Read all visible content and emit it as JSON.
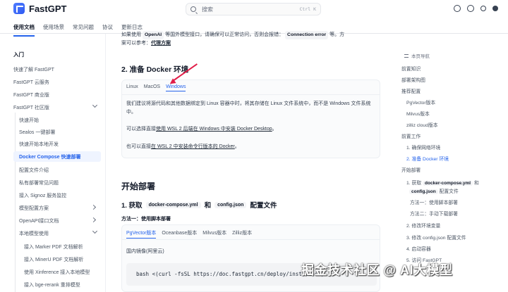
{
  "app": {
    "name": "FastGPT"
  },
  "search": {
    "placeholder": "搜索",
    "shortcut": "Ctrl K"
  },
  "header_icons": [
    "openai-icon",
    "github-icon",
    "sun-icon",
    "moon-icon"
  ],
  "top_tabs": [
    {
      "label": "使用文档",
      "active": true
    },
    {
      "label": "使用场景",
      "active": false
    },
    {
      "label": "常见问题",
      "active": false
    },
    {
      "label": "协议",
      "active": false
    },
    {
      "label": "更新日志",
      "active": false
    }
  ],
  "sidebar": {
    "section": "入门",
    "items": [
      {
        "label": "快速了解 FastGPT"
      },
      {
        "label": "FastGPT 云服务"
      },
      {
        "label": "FastGPT 商业版"
      },
      {
        "label": "FastGPT 社区版"
      },
      {
        "label": "快速开始"
      },
      {
        "label": "Sealos 一键部署"
      },
      {
        "label": "快速开始本地开发"
      },
      {
        "label": "Docker Compose 快速部署"
      },
      {
        "label": "配置文件介绍"
      },
      {
        "label": "私有部署常见问题"
      },
      {
        "label": "接入 Signoz 服务监控"
      },
      {
        "label": "模型配置方案"
      },
      {
        "label": "OpenAPI接口文档"
      },
      {
        "label": "本地模型使用"
      },
      {
        "label": "接入 Marker PDF 文档解析"
      },
      {
        "label": "接入 MinerU PDF 文档解析"
      },
      {
        "label": "使用 Xinference 接入本地模型"
      },
      {
        "label": "接入 bge-rerank 重排模型"
      }
    ]
  },
  "main": {
    "intro_line1_prefix": "如果使用",
    "intro_code1": "OpenAI",
    "intro_line1_mid": "等国外模型接口，请确保可以正常访问，否则会报错：",
    "intro_code2": "Connection error",
    "intro_line1_suffix": "等。方",
    "intro_line2_prefix": "案可以参考：",
    "intro_link": "代理方案",
    "h2_docker": "2. 准备 Docker 环境",
    "os_tabs": [
      {
        "label": "Linux",
        "active": false
      },
      {
        "label": "MacOS",
        "active": false
      },
      {
        "label": "Windows",
        "active": true
      }
    ],
    "win_p1": "我们建议将源代码和其他数据绑定到 Linux 容器中时，将其存储在 Linux 文件系统中，而不是 Windows 文件系统中。",
    "win_p2_prefix": "可以选择直接",
    "win_p2_link": "使用 WSL 2 后端在 Windows 中安装 Docker Desktop",
    "win_p2_suffix": "。",
    "win_p3_prefix": "也可以直接",
    "win_p3_link": "在 WSL 2 中安装命令行版本的 Docker",
    "win_p3_suffix": "。",
    "h2_deploy": "开始部署",
    "h3_get_prefix": "1. 获取",
    "h3_get_code1": "docker-compose.yml",
    "h3_get_and": "和",
    "h3_get_code2": "config.json",
    "h3_get_suffix": "配置文件",
    "method1": "方法一：使用脚本部署",
    "db_tabs": [
      {
        "label": "PgVector版本",
        "active": true
      },
      {
        "label": "Oceanbase版本",
        "active": false
      },
      {
        "label": "Milvus版本",
        "active": false
      },
      {
        "label": "Zilliz版本",
        "active": false
      }
    ],
    "mirror_label": "国内镜像(阿里云)",
    "code_line": "bash <(curl -fsSL https://doc.fastgpt.cn/deploy/install.sh)"
  },
  "toc": {
    "title": "本页导航",
    "items": [
      {
        "label": "前置知识"
      },
      {
        "label": "部署架构图"
      },
      {
        "label": "推荐配置"
      },
      {
        "label": "PgVector版本"
      },
      {
        "label": "Milvus版本"
      },
      {
        "label": "zilliz cloud版本"
      },
      {
        "label": "前置工作"
      },
      {
        "label": "1. 确保网络环境"
      },
      {
        "label": "2. 准备 Docker 环境"
      },
      {
        "label": "开始部署"
      },
      {
        "label": "1. 获取"
      },
      {
        "label": "docker-compose.yml"
      },
      {
        "label": "和"
      },
      {
        "label": "config.json"
      },
      {
        "label": "配置文件"
      },
      {
        "label": "方法一：使用脚本部署"
      },
      {
        "label": "方法二：手动下载部署"
      },
      {
        "label": "2. 修改环境变量"
      },
      {
        "label": "3. 修改 config.json 配置文件"
      },
      {
        "label": "4. 启动容器"
      },
      {
        "label": "5. 访问 FastGPT"
      }
    ]
  },
  "watermark": "掘金技术社区 @ AI大模型",
  "colors": {
    "accent": "#2563eb",
    "arrow": "#e11d48"
  }
}
